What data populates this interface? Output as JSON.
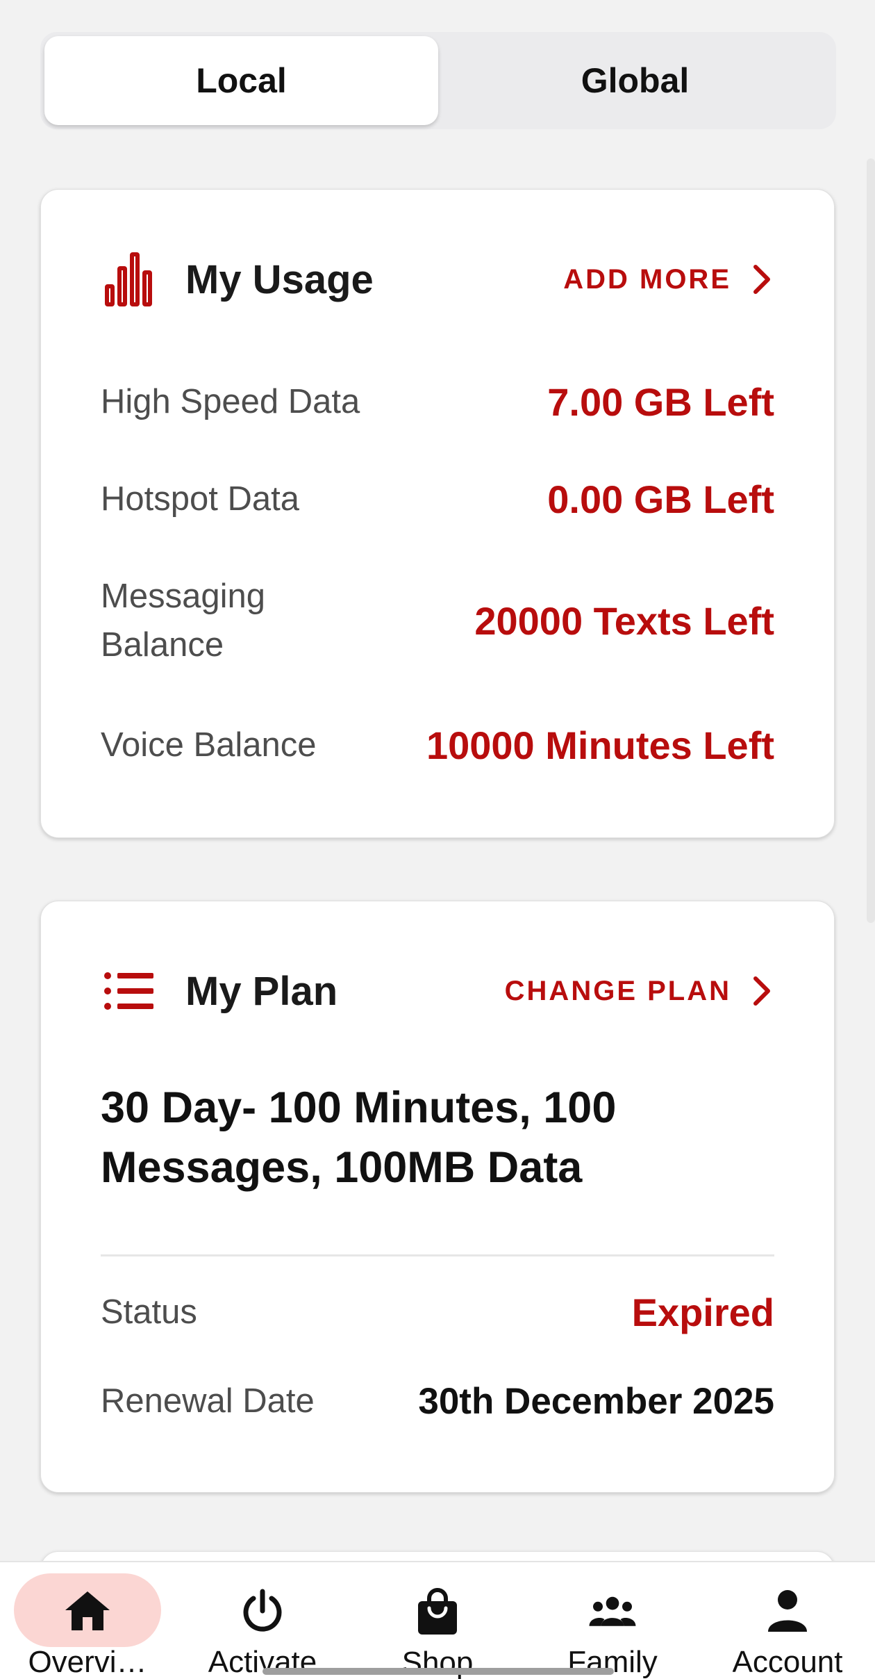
{
  "colors": {
    "accent": "#b80d0d",
    "nav_active_bg": "#fbd6d3"
  },
  "tabs": [
    {
      "label": "Local",
      "active": true
    },
    {
      "label": "Global",
      "active": false
    }
  ],
  "usage": {
    "icon": "bar-chart-icon",
    "title": "My Usage",
    "action_label": "ADD MORE",
    "rows": [
      {
        "label": "High Speed Data",
        "value": "7.00 GB Left"
      },
      {
        "label": "Hotspot Data",
        "value": "0.00 GB Left"
      },
      {
        "label": "Messaging Balance",
        "value": "20000 Texts Left"
      },
      {
        "label": "Voice Balance",
        "value": "10000 Minutes Left"
      }
    ]
  },
  "plan": {
    "icon": "list-icon",
    "title": "My Plan",
    "action_label": "CHANGE PLAN",
    "name": "30 Day- 100 Minutes, 100 Messages, 100MB Data",
    "status_label": "Status",
    "status_value": "Expired",
    "renewal_label": "Renewal Date",
    "renewal_value": "30th December 2025"
  },
  "nav": [
    {
      "label": "Overvi…",
      "icon": "home-icon",
      "active": true
    },
    {
      "label": "Activate",
      "icon": "power-icon",
      "active": false
    },
    {
      "label": "Shop",
      "icon": "shopping-bag-icon",
      "active": false
    },
    {
      "label": "Family",
      "icon": "group-icon",
      "active": false
    },
    {
      "label": "Account",
      "icon": "person-icon",
      "active": false
    }
  ]
}
